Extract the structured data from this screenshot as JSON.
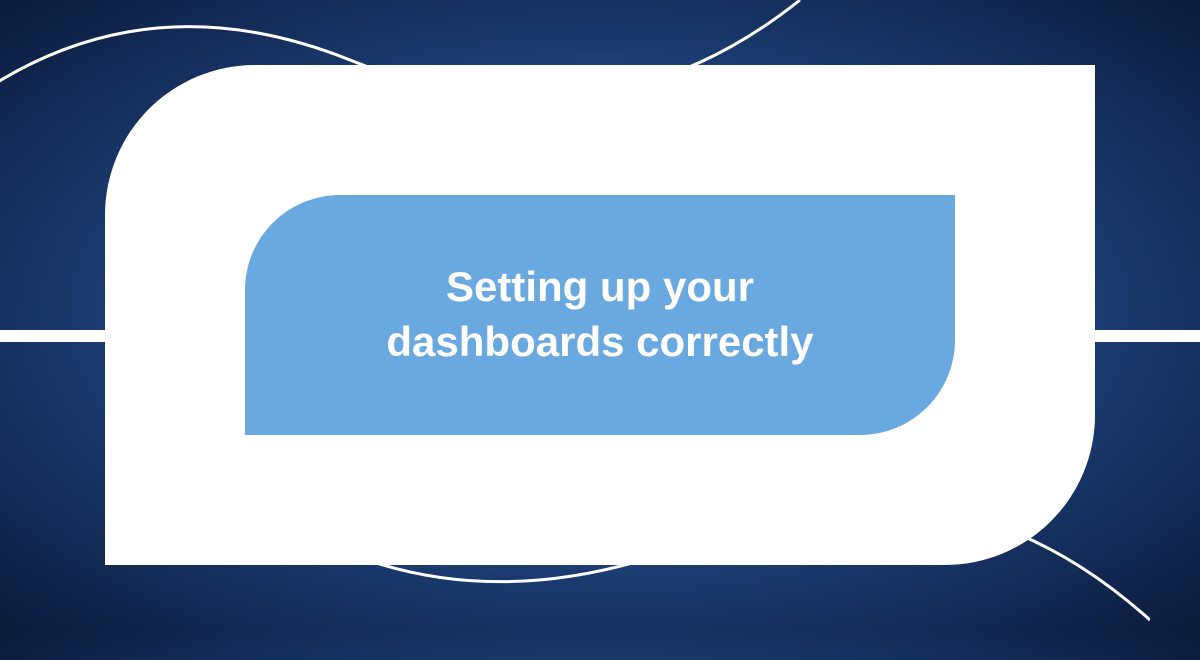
{
  "title": "Setting up your\ndashboards correctly",
  "colors": {
    "background_dark": "#0a1a3a",
    "background_light": "#4a7db8",
    "inner_panel": "#6aa8e0",
    "shape": "#ffffff",
    "text": "#ffffff"
  }
}
